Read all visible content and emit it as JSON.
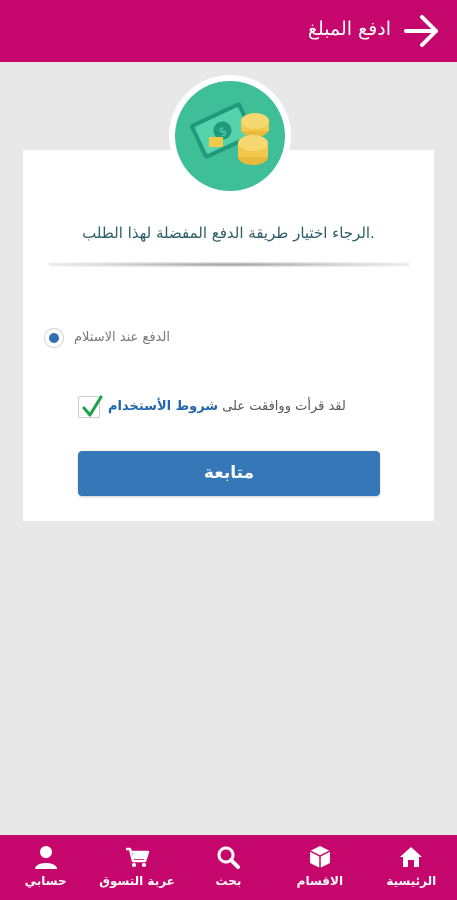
{
  "header": {
    "title": "ادفع المبلغ",
    "back_icon": "arrow-right-icon"
  },
  "card": {
    "badge_icon": "money-coins-icon",
    "prompt": ".الرجاء اختيار طريقة الدفع المفضلة لهذا الطلب",
    "payment_options": [
      {
        "label": "الدفع عند الاستلام",
        "selected": true
      }
    ],
    "terms": {
      "prefix": "لقد قرأت ووافقت على",
      "link": "شروط الأستخدام",
      "checked": true
    },
    "continue_label": "متابعة"
  },
  "bottom_nav": [
    {
      "label": "الرئيسية",
      "icon": "home-icon"
    },
    {
      "label": "الاقسام",
      "icon": "cube-icon"
    },
    {
      "label": "بحث",
      "icon": "search-icon"
    },
    {
      "label": "عربة التسوق",
      "icon": "cart-icon"
    },
    {
      "label": "حسابي",
      "icon": "user-icon"
    }
  ],
  "colors": {
    "primary": "#c5066c",
    "button": "#3677b8",
    "badge": "#3fbf98",
    "check": "#1aa14a"
  }
}
